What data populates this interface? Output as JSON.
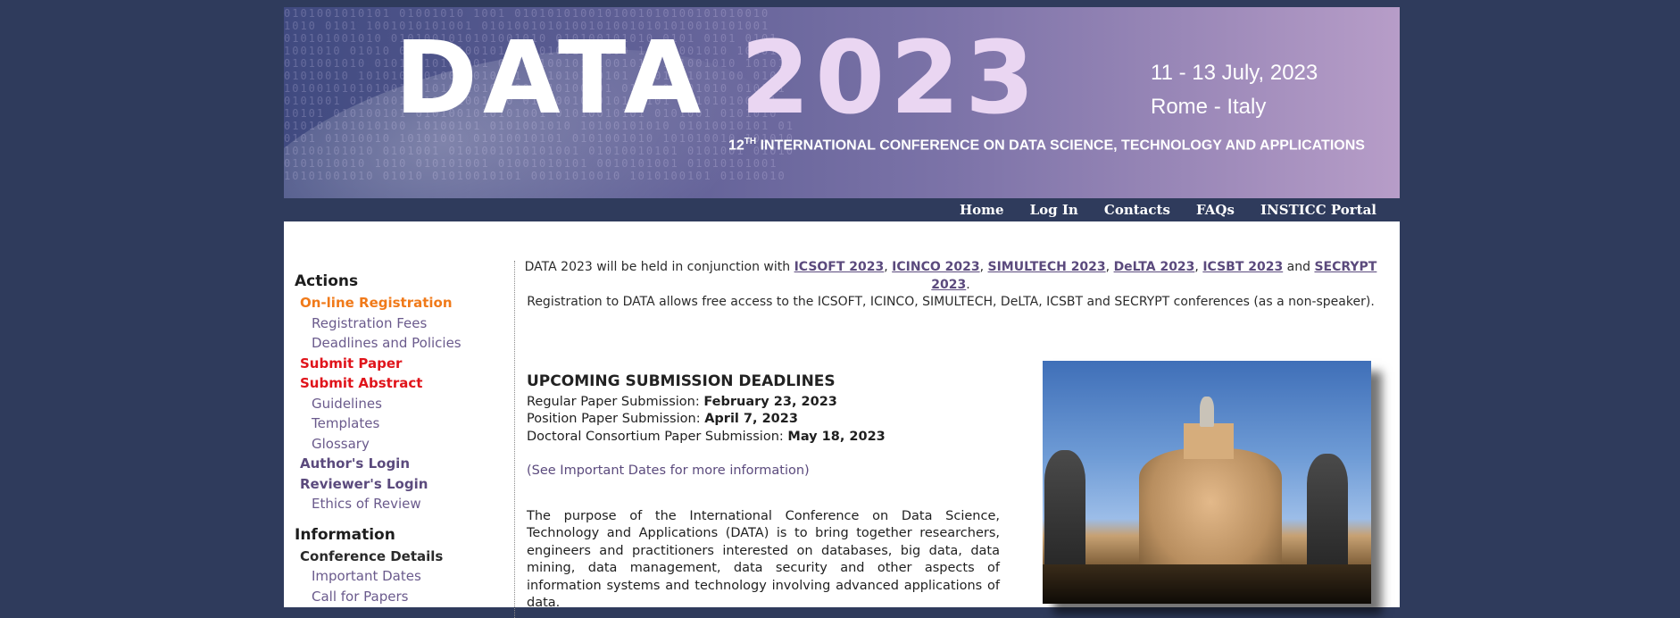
{
  "banner": {
    "title_word": "DATA",
    "title_year": "2023",
    "dates": "11 - 13 July, 2023",
    "location": "Rome - Italy",
    "ordinal_number": "12",
    "ordinal_suffix": "TH",
    "subtitle_rest": " INTERNATIONAL CONFERENCE ON DATA SCIENCE, TECHNOLOGY AND APPLICATIONS"
  },
  "topnav": [
    "Home",
    "Log In",
    "Contacts",
    "FAQs",
    "INSTICC Portal"
  ],
  "intro": {
    "prefix": "DATA 2023 will be held in conjunction with ",
    "links": [
      "ICSOFT 2023",
      "ICINCO 2023",
      "SIMULTECH 2023",
      "DeLTA 2023",
      "ICSBT 2023",
      "SECRYPT 2023"
    ],
    "sep_comma": ", ",
    "sep_and": " and ",
    "suffix": ".",
    "line2": "Registration to DATA allows free access to the ICSOFT, ICINCO, SIMULTECH, DeLTA, ICSBT and SECRYPT conferences (as a non-speaker)."
  },
  "sidebar": {
    "actions_title": "Actions",
    "actions": [
      "On-line Registration",
      "Registration Fees",
      "Deadlines and Policies",
      "Submit Paper",
      "Submit Abstract",
      "Guidelines",
      "Templates",
      "Glossary",
      "Author's Login",
      "Reviewer's Login",
      "Ethics of Review"
    ],
    "information_title": "Information",
    "information": [
      "Conference Details",
      "Important Dates",
      "Call for Papers"
    ]
  },
  "deadlines": {
    "title": "UPCOMING SUBMISSION DEADLINES",
    "items": [
      {
        "label": "Regular Paper Submission: ",
        "date": "February 23, 2023"
      },
      {
        "label": "Position Paper Submission: ",
        "date": "April 7, 2023"
      },
      {
        "label": "Doctoral Consortium Paper Submission: ",
        "date": "May 18, 2023"
      }
    ],
    "more": "(See Important Dates for more information)",
    "purpose": "The purpose of the International Conference on Data Science, Technology and Applications (DATA) is to bring together researchers, engineers and practitioners interested on databases, big data, data mining, data management, data security and other aspects of information systems and technology involving advanced applications of data."
  },
  "colors": {
    "page_bg": "#2f3b5c",
    "link_purple": "#5b4a7d",
    "highlight_orange": "#f07a1a",
    "highlight_red": "#e0141b"
  }
}
